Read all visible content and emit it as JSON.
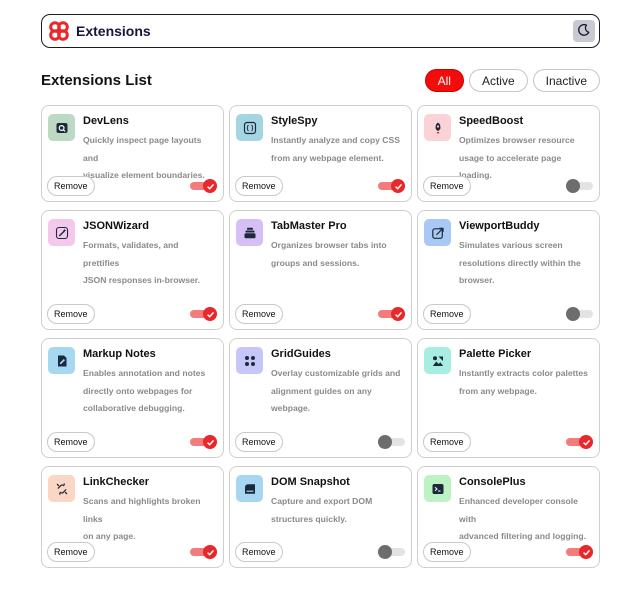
{
  "header": {
    "brand": "Extensions"
  },
  "list_title": "Extensions List",
  "filters": [
    "All",
    "Active",
    "Inactive"
  ],
  "active_filter": "All",
  "remove_label": "Remove",
  "extensions": [
    {
      "name": "DevLens",
      "desc": [
        "Quickly inspect page layouts and",
        "visualize element boundaries."
      ],
      "active": true,
      "icon": "magnifier-box-icon",
      "icon_bg": "#bcd9c4"
    },
    {
      "name": "StyleSpy",
      "desc": [
        "Instantly analyze and copy CSS",
        "from any webpage element."
      ],
      "active": true,
      "icon": "code-braces-icon",
      "icon_bg": "#a6d5e2"
    },
    {
      "name": "SpeedBoost",
      "desc": [
        "Optimizes browser resource",
        "usage to accelerate page loading."
      ],
      "active": false,
      "icon": "rocket-icon",
      "icon_bg": "#fbd2d6"
    },
    {
      "name": "JSONWizard",
      "desc": [
        "Formats, validates, and prettifies",
        "JSON responses in-browser."
      ],
      "active": true,
      "icon": "wand-icon",
      "icon_bg": "#f3c8ec"
    },
    {
      "name": "TabMaster Pro",
      "desc": [
        "Organizes browser tabs into",
        "groups and sessions."
      ],
      "active": true,
      "icon": "tabs-stack-icon",
      "icon_bg": "#d6bff5"
    },
    {
      "name": "ViewportBuddy",
      "desc": [
        "Simulates various screen",
        "resolutions directly within the",
        "browser."
      ],
      "active": false,
      "icon": "resize-arrow-icon",
      "icon_bg": "#a9c8f5"
    },
    {
      "name": "Markup Notes",
      "desc": [
        "Enables annotation and notes",
        "directly onto webpages for",
        "collaborative debugging."
      ],
      "active": true,
      "icon": "note-pen-icon",
      "icon_bg": "#a6d8f2"
    },
    {
      "name": "GridGuides",
      "desc": [
        "Overlay customizable grids and",
        "alignment guides on any",
        "webpage."
      ],
      "active": false,
      "icon": "grid-icon",
      "icon_bg": "#c6c6f8"
    },
    {
      "name": "Palette Picker",
      "desc": [
        "Instantly extracts color palettes",
        "from any webpage."
      ],
      "active": true,
      "icon": "palette-icon",
      "icon_bg": "#a8ede2"
    },
    {
      "name": "LinkChecker",
      "desc": [
        "Scans and highlights broken links",
        "on any page."
      ],
      "active": true,
      "icon": "broken-link-icon",
      "icon_bg": "#fcd6c4"
    },
    {
      "name": "DOM Snapshot",
      "desc": [
        "Capture and export DOM",
        "structures quickly."
      ],
      "active": false,
      "icon": "snapshot-icon",
      "icon_bg": "#a6d6f0"
    },
    {
      "name": "ConsolePlus",
      "desc": [
        "Enhanced developer console with",
        "advanced filtering and logging."
      ],
      "active": true,
      "icon": "terminal-icon",
      "icon_bg": "#bdf2c4"
    }
  ],
  "colors": {
    "accent": "#f20d0d",
    "toggle_on": "#e8282b",
    "toggle_track_on": "#f27b7b",
    "toggle_off": "#6d6d6d"
  }
}
